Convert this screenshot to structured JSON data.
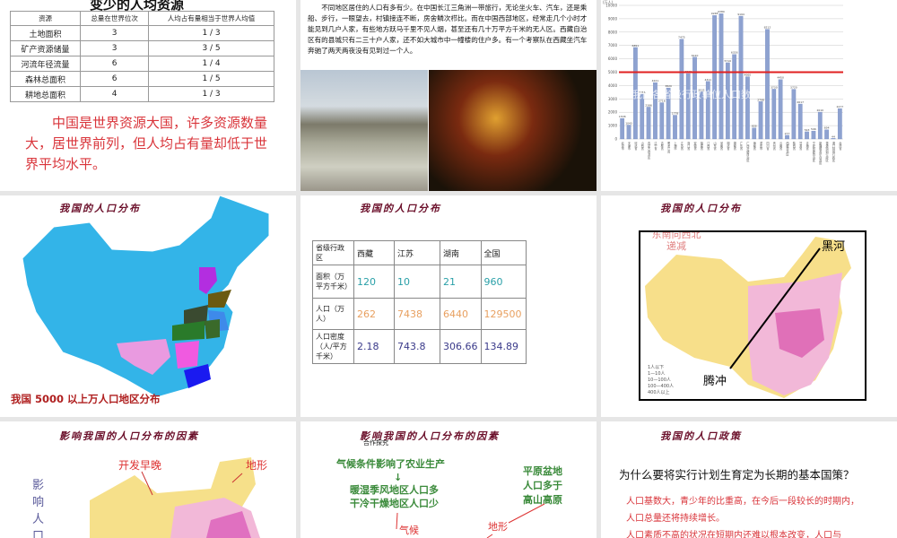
{
  "slide1": {
    "title": "变少的人均资源",
    "headers": [
      "资源",
      "总量在世界位次",
      "人均占有量相当于世界人均值"
    ],
    "rows": [
      [
        "土地面积",
        "3",
        "1 / 3"
      ],
      [
        "矿产资源储量",
        "3",
        "3 / 5"
      ],
      [
        "河流年径流量",
        "6",
        "1 / 4"
      ],
      [
        "森林总面积",
        "6",
        "1 / 5"
      ],
      [
        "耕地总面积",
        "4",
        "1 / 3"
      ]
    ],
    "summary": "中国是世界资源大国，许多资源数量大，居世界前列，但人均占有量却低于世界平均水平。"
  },
  "slide2": {
    "text": "不同地区居住的人口有多有少。在中国长江三角洲一带旅行，无论坐火车、汽车，还是乘船、步行，一眼望去，村镇接连不断，房舍鳞次栉比。而在中国西部地区，经常走几个小时才能见到几户人家，有些地方跃马千里不见人烟，甚至还有几十万平方千米的无人区。西藏自治区有的县城只有二三十户人家，还不如大城市中一幢楼的住户多。有一个考察队在西藏坐汽车奔驰了两天两夜没有见到过一个人。"
  },
  "chart_data": {
    "type": "bar",
    "ylabel": "(万人)",
    "ylim": [
      0,
      10000
    ],
    "yticks": [
      0,
      1000,
      2000,
      3000,
      4000,
      5000,
      6000,
      7000,
      8000,
      9000,
      10000
    ],
    "overlay": "我国各省级行政单位人口数量",
    "reference_line": 5000,
    "reference_color": "#e02020",
    "categories": [
      "北京市",
      "天津市",
      "河北省",
      "山西省",
      "内蒙古自治区",
      "辽宁省",
      "吉林省",
      "黑龙江省",
      "上海市",
      "江苏省",
      "浙江省",
      "安徽省",
      "福建省",
      "江西省",
      "山东省",
      "河南省",
      "湖北省",
      "湖南省",
      "广东省",
      "广西壮族自治区",
      "海南省",
      "重庆市",
      "四川省",
      "贵州省",
      "云南省",
      "西藏自治区",
      "陕西省",
      "甘肃省",
      "青海省",
      "宁夏回族自治区",
      "新疆维吾尔自治区",
      "香港特别行政区",
      "澳门特别行政区",
      "台湾省"
    ],
    "values": [
      1538,
      1043,
      6851,
      3355,
      2386,
      4221,
      2716,
      3820,
      1778,
      7475,
      4898,
      6120,
      3535,
      4311,
      9248,
      9380,
      5710,
      6326,
      9194,
      4660,
      828,
      2798,
      8212,
      3730,
      4450,
      277,
      3720,
      2617,
      543,
      596,
      2010,
      694,
      44,
      2277
    ]
  },
  "slide4": {
    "title": "我国的人口分布",
    "caption": "我国 5000 以上万人口地区分布"
  },
  "slide5": {
    "title": "我国的人口分布",
    "headers": [
      "省级行政区",
      "西藏",
      "江苏",
      "湖南",
      "全国"
    ],
    "rows": [
      {
        "label": "面积（万平方千米）",
        "values": [
          "120",
          "10",
          "21",
          "960"
        ]
      },
      {
        "label": "人口（万人）",
        "values": [
          "262",
          "7438",
          "6440",
          "129500"
        ]
      },
      {
        "label": "人口密度（人/平方千米）",
        "values": [
          "2.18",
          "743.8",
          "306.66",
          "134.89"
        ]
      }
    ]
  },
  "slide6": {
    "title": "我国的人口分布",
    "trend": "东南向西北递减",
    "north": "黑河",
    "south": "腾冲",
    "legend": [
      "1人以下",
      "1—10人",
      "10—100人",
      "100—400人",
      "400人以上"
    ]
  },
  "slide7": {
    "title": "影响我国的人口分布的因素",
    "label1": "开发早晚",
    "label2": "地形",
    "side": "影响人口分"
  },
  "slide8": {
    "title": "影响我国的人口分布的因素",
    "sub": "合作探究",
    "climate1": "气候条件影响了农业生产",
    "arrow": "↓",
    "climate2": "暖湿季风地区人口多",
    "climate3": "干冷干燥地区人口少",
    "terrain": "平原盆地人口多于高山高原",
    "lbl_climate": "气候",
    "lbl_terrain": "地形"
  },
  "slide9": {
    "title": "我国的人口政策",
    "question": "为什么要将实行计划生育定为长期的基本国策？",
    "answers": [
      "人口基数大，青少年的比重高，在今后一段较长的时期内，",
      "人口总量还将持续增长。",
      "人口素质不高的状况在短期内还难以根本改变，人口与"
    ]
  }
}
